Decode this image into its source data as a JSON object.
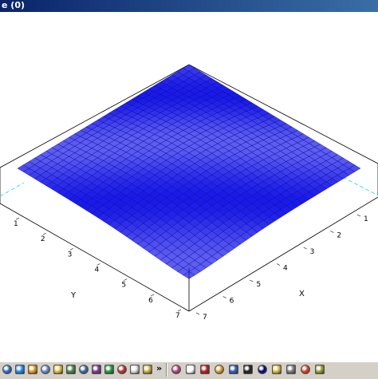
{
  "window": {
    "title_fragment": "e (0)"
  },
  "plot": {
    "x_axis_label": "X",
    "y_axis_label": "Y",
    "x_ticks": [
      "1",
      "2",
      "3",
      "4",
      "5",
      "6",
      "7"
    ],
    "y_ticks": [
      "1",
      "2",
      "3",
      "4",
      "5",
      "6",
      "7"
    ],
    "surface_color": "#1a1ae6",
    "grid_color": "#0000aa",
    "frame_color": "#000000",
    "dash_color": "#40e0e0"
  },
  "taskbar": {
    "chevron": "»",
    "icons": [
      "globe-icon",
      "ie-icon",
      "media-icon",
      "mail-icon",
      "explorer-icon",
      "window-icon",
      "monitor-icon",
      "network-icon",
      "messenger-icon",
      "app-icon",
      "notepad-icon",
      "folder-icon",
      "paint-icon",
      "doc-icon",
      "chart-icon",
      "calc-icon",
      "window2-icon",
      "terminal-icon",
      "monitor2-icon",
      "pencil-icon",
      "tools-icon",
      "spark-icon",
      "paint2-icon"
    ]
  }
}
